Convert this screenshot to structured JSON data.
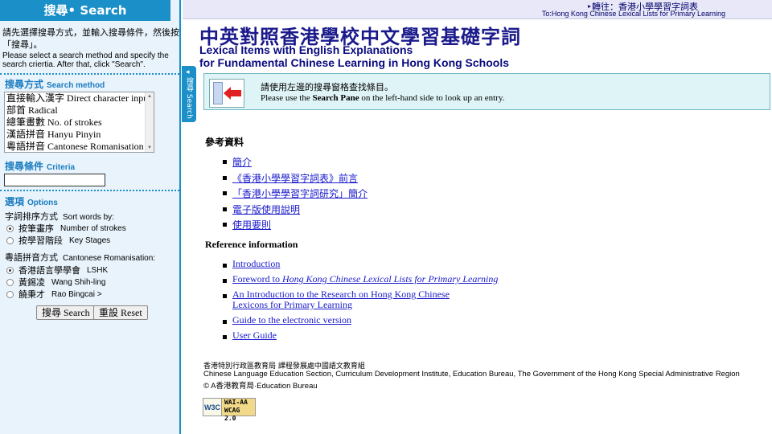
{
  "sidebar": {
    "header": "搜尋• Search",
    "instructions_zh": "請先選擇搜尋方式，並輸入搜尋條件，然後按「搜尋」。",
    "instructions_en": "Please select a search method and specify the search criertia. After that, click \"Search\".",
    "method_title_zh": "搜尋方式",
    "method_title_en": "Search method",
    "methods": [
      "直接輸入漢字 Direct character input",
      "部首 Radical",
      "總筆畫數 No. of strokes",
      "漢語拼音 Hanyu Pinyin",
      "粵語拼音 Cantonese Romanisation"
    ],
    "criteria_title_zh": "搜尋條件",
    "criteria_title_en": "Criteria",
    "criteria_value": "",
    "options_title_zh": "選項",
    "options_title_en": "Options",
    "sort_label_zh": "字詞排序方式",
    "sort_label_en": "Sort words by:",
    "sort_options": [
      {
        "zh": "按筆畫序",
        "en": "Number of strokes",
        "checked": true
      },
      {
        "zh": "按學習階段",
        "en": "Key Stages",
        "checked": false
      }
    ],
    "roman_label_zh": "粵語拼音方式",
    "roman_label_en": "Cantonese Romanisation:",
    "roman_options": [
      {
        "zh": "香港語言學學會",
        "en": "LSHK",
        "checked": true
      },
      {
        "zh": "黃錫凌",
        "en": "Wang Shih-ling",
        "checked": false
      },
      {
        "zh": "饒秉才",
        "en": "Rao Bingcai >",
        "checked": false
      }
    ],
    "search_button": "搜尋 Search",
    "reset_button": "重設 Reset"
  },
  "collapse_tab": {
    "arrow": "◂",
    "label": "搜尋 Search"
  },
  "topbar": {
    "redirect_zh": "‣轉往：香港小學學習字詞表",
    "redirect_en": "To:Hong Kong Chinese Lexical Lists for Primary Learning"
  },
  "main": {
    "title_zh": "中英對照香港學校中文學習基礎字詞",
    "title_en_1": "Lexical Items with English Explanations",
    "title_en_2": "for Fundamental Chinese Learning in Hong Kong Schools",
    "notice_zh": "請使用左邊的搜尋窗格查找條目。",
    "notice_en_pre": "Please use the ",
    "notice_en_bold": "Search Pane",
    "notice_en_post": " on the left-hand side to look up an entry.",
    "ref_heading_zh": "參考資料",
    "ref_links_zh": [
      "簡介",
      "《香港小學學習字詞表》前言",
      "「香港小學學習字詞研究」簡介",
      "電子版使用說明",
      "使用要則"
    ],
    "ref_heading_en": "Reference information",
    "ref_links_en": {
      "introduction": "Introduction",
      "foreword_pre": "Foreword to ",
      "foreword_italic": "Hong Kong Chinese Lexical Lists for Primary Learning",
      "research_line1": "An Introduction to the Research on Hong Kong Chinese",
      "research_line2": "Lexicons for Primary Learning",
      "guide": "Guide to the electronic version",
      "user_guide": "User Guide"
    },
    "footer_zh": "香港特別行政區教育局 課程發展處中國語文教育組",
    "footer_en": "Chinese Language Education Section, Curriculum Development Institute, Education Bureau, The Government of the Hong Kong Special Administrative Region",
    "footer_copyright": "© A香港教育局·Education Bureau",
    "badge_w3c": "W3C",
    "badge_line1": "WAI-AA",
    "badge_line2": "WCAG 2.0"
  }
}
